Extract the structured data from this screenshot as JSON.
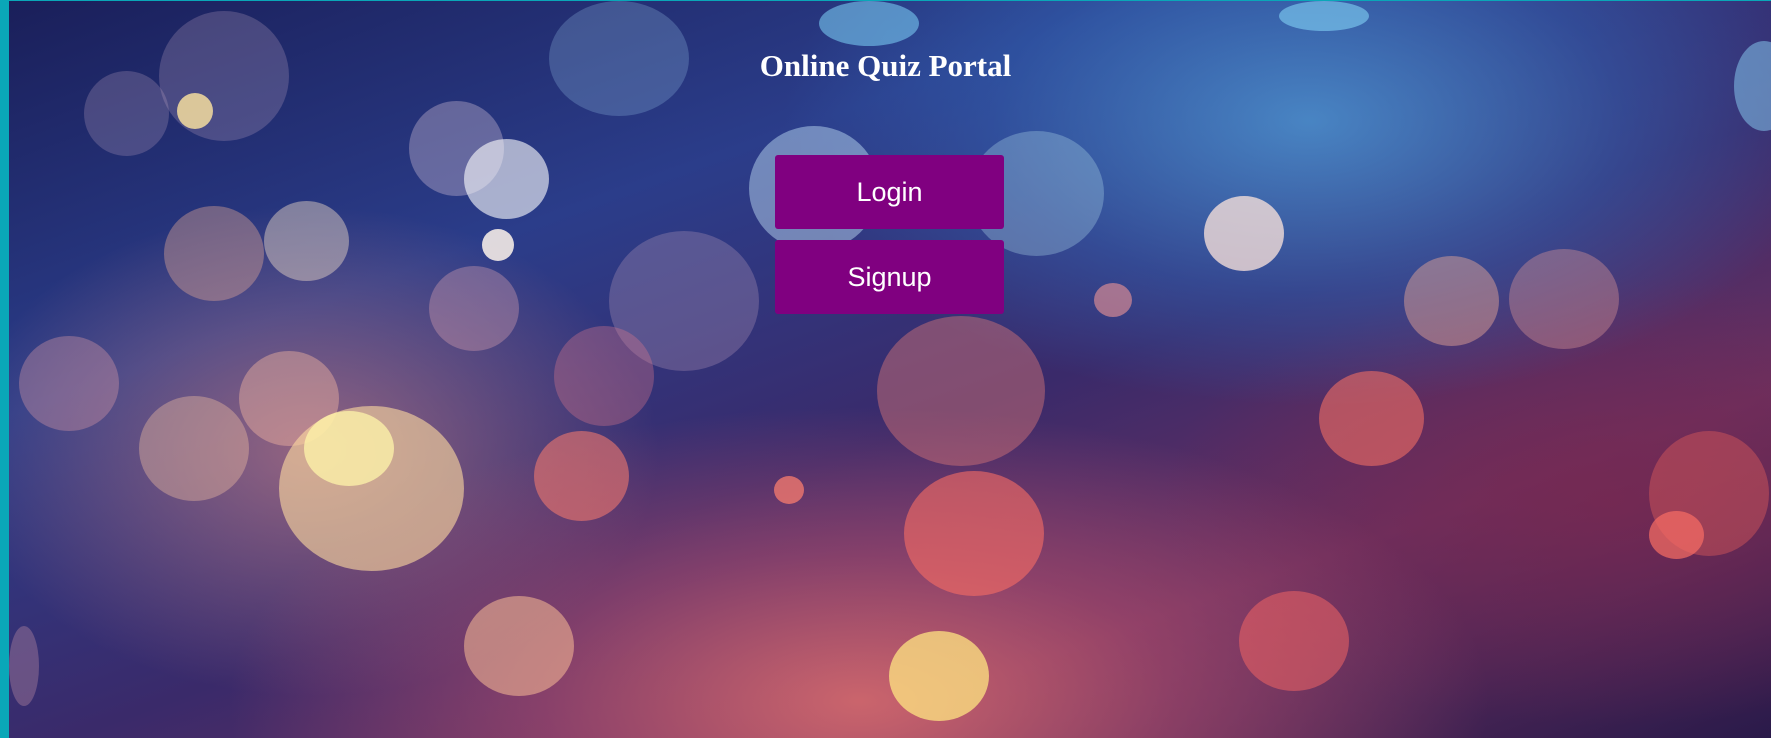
{
  "page": {
    "title": "Online Quiz Portal"
  },
  "actions": {
    "login_label": "Login",
    "signup_label": "Signup"
  },
  "colors": {
    "button_background": "#800080",
    "button_text": "#ffffff",
    "title_text": "#ffffff",
    "frame": "#0aa7b8"
  }
}
